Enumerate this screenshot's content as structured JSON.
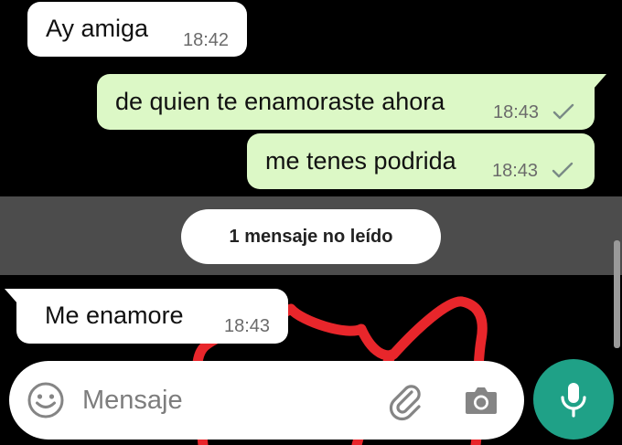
{
  "chat": {
    "messages": [
      {
        "direction": "incoming",
        "text": "Ay amiga",
        "time": "18:42"
      },
      {
        "direction": "outgoing",
        "text": "de quien te enamoraste ahora",
        "time": "18:43",
        "status": "sent"
      },
      {
        "direction": "outgoing",
        "text": "me tenes podrida",
        "time": "18:43",
        "status": "sent"
      },
      {
        "direction": "incoming",
        "text": "Me enamore",
        "time": "18:43"
      }
    ],
    "unread_label": "1 mensaje no leído"
  },
  "composer": {
    "placeholder": "Mensaje",
    "value": ""
  },
  "colors": {
    "background": "#000000",
    "incoming_bubble": "#ffffff",
    "outgoing_bubble": "#dcf8c6",
    "accent": "#1fa187",
    "scribble": "#e8262b"
  },
  "icons": [
    "emoji-icon",
    "paperclip-icon",
    "camera-icon",
    "microphone-icon",
    "check-icon"
  ]
}
